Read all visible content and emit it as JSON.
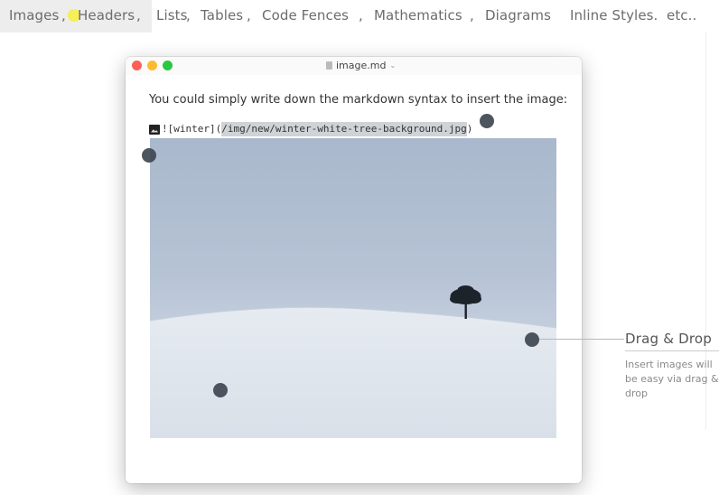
{
  "nav": {
    "items": [
      {
        "label": "Images",
        "active": true
      },
      {
        "label": "Headers"
      },
      {
        "label": "Lists"
      },
      {
        "label": "Tables"
      },
      {
        "label": "Code Fences"
      },
      {
        "label": "Mathematics"
      },
      {
        "label": "Diagrams"
      },
      {
        "label": "Inline Styles."
      },
      {
        "label": "etc.."
      }
    ],
    "separator": ","
  },
  "window": {
    "title": "image.md",
    "traffic_colors": {
      "close": "#fc5f57",
      "minimize": "#fdbb2d",
      "zoom": "#28c840"
    }
  },
  "document": {
    "sentence": "You could simply write down the markdown syntax to insert the image:",
    "markdown": {
      "prefix": "![winter](",
      "path": "/img/new/winter-white-tree-background.jpg",
      "suffix": ")"
    }
  },
  "annotation": {
    "title": "Drag & Drop",
    "description": "Insert images will be easy via drag & drop"
  },
  "colors": {
    "cursor_dot": "#3e4651",
    "highlight": "#f7ef3a",
    "selection": "#cfd3d8"
  }
}
